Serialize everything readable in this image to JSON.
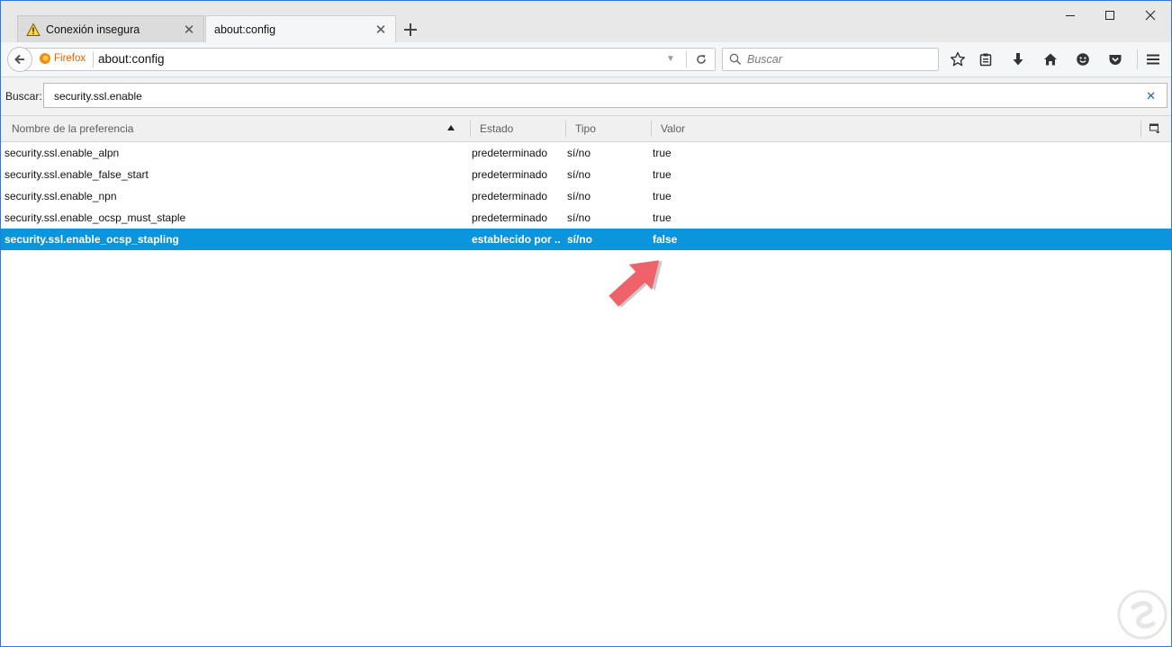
{
  "tabs": [
    {
      "label": "Conexión insegura",
      "icon": "warning-icon",
      "active": false
    },
    {
      "label": "about:config",
      "active": true
    }
  ],
  "navbar": {
    "identity_label": "Firefox",
    "url": "about:config",
    "search_placeholder": "Buscar"
  },
  "config_search": {
    "label": "Buscar:",
    "value": "security.ssl.enable"
  },
  "table": {
    "headers": {
      "name": "Nombre de la preferencia",
      "state": "Estado",
      "type": "Tipo",
      "value": "Valor"
    },
    "rows": [
      {
        "name": "security.ssl.enable_alpn",
        "state": "predeterminado",
        "type": "sí/no",
        "value": "true"
      },
      {
        "name": "security.ssl.enable_false_start",
        "state": "predeterminado",
        "type": "sí/no",
        "value": "true"
      },
      {
        "name": "security.ssl.enable_npn",
        "state": "predeterminado",
        "type": "sí/no",
        "value": "true"
      },
      {
        "name": "security.ssl.enable_ocsp_must_staple",
        "state": "predeterminado",
        "type": "sí/no",
        "value": "true"
      },
      {
        "name": "security.ssl.enable_ocsp_stapling",
        "state": "establecido por ...",
        "type": "sí/no",
        "value": "false",
        "selected": true
      }
    ]
  },
  "colors": {
    "selection": "#0a95dd",
    "annotation_arrow": "#f0626a",
    "firefox_orange": "#e66000",
    "window_border": "#2b79d6"
  }
}
